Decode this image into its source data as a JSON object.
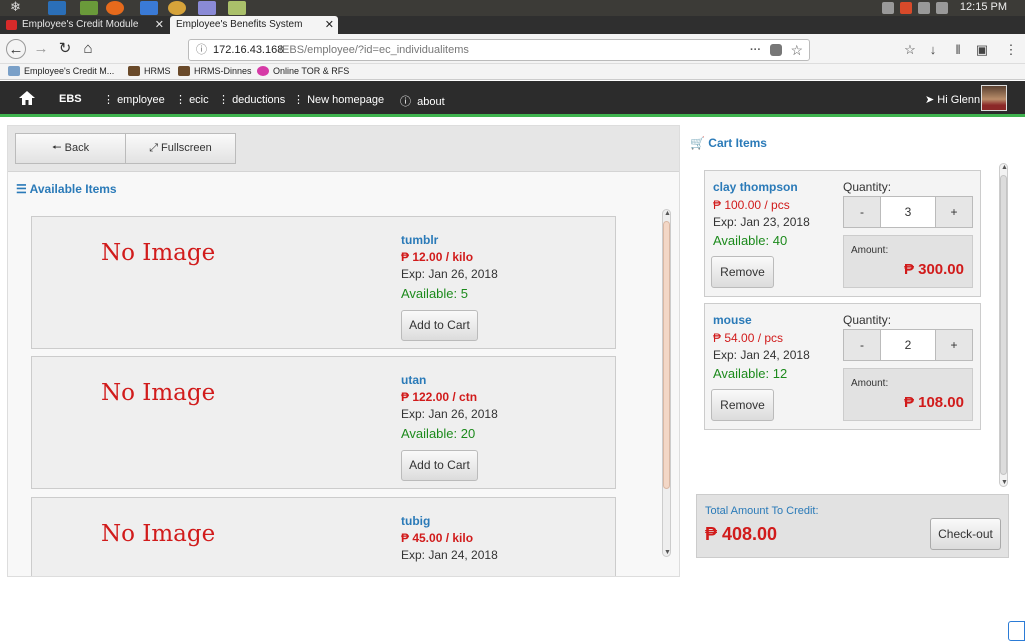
{
  "os": {
    "clock": "12:15 PM"
  },
  "browser": {
    "tabs": [
      {
        "label": "Employee's Credit Module",
        "active": false
      },
      {
        "label": "Employee's Benefits System",
        "active": true
      }
    ],
    "new_tab": "+",
    "url_host": "172.16.43.168",
    "url_path": "/EBS/employee/?id=ec_individualitems",
    "url_menu": "···",
    "bookmarks": [
      {
        "label": "Employee's Credit M..."
      },
      {
        "label": "HRMS"
      },
      {
        "label": "HRMS-Dinnes"
      },
      {
        "label": "Online TOR & RFS"
      }
    ]
  },
  "appnav": {
    "brand": "EBS",
    "menu": [
      {
        "label": "employee"
      },
      {
        "label": "ecic"
      },
      {
        "label": "deductions"
      },
      {
        "label": "New homepage"
      }
    ],
    "about": "about",
    "greeting": "Hi Glenn"
  },
  "toolbar": {
    "back": "Back",
    "fullscreen": "Fullscreen"
  },
  "available": {
    "title": "Available Items",
    "items": [
      {
        "image": "No Image",
        "name": "tumblr",
        "price": "₱ 12.00 / kilo",
        "exp": "Exp: Jan 26, 2018",
        "available": "Available: 5",
        "button": "Add to Cart"
      },
      {
        "image": "No Image",
        "name": "utan",
        "price": "₱ 122.00 / ctn",
        "exp": "Exp: Jan 26, 2018",
        "available": "Available: 20",
        "button": "Add to Cart"
      },
      {
        "image": "No Image",
        "name": "tubig",
        "price": "₱ 45.00 / kilo",
        "exp": "Exp: Jan 24, 2018",
        "available": "",
        "button": ""
      }
    ]
  },
  "cart": {
    "title": "Cart Items",
    "items": [
      {
        "name": "clay thompson",
        "price": "₱ 100.00 / pcs",
        "exp": "Exp: Jan 23, 2018",
        "available": "Available: 40",
        "remove": "Remove",
        "qty_label": "Quantity:",
        "minus": "-",
        "qty": "3",
        "plus": "+",
        "amount_label": "Amount:",
        "amount": "₱ 300.00"
      },
      {
        "name": "mouse",
        "price": "₱ 54.00 / pcs",
        "exp": "Exp: Jan 24, 2018",
        "available": "Available: 12",
        "remove": "Remove",
        "qty_label": "Quantity:",
        "minus": "-",
        "qty": "2",
        "plus": "+",
        "amount_label": "Amount:",
        "amount": "₱ 108.00"
      }
    ],
    "total_label": "Total Amount To Credit:",
    "total": "₱ 408.00",
    "checkout": "Check-out"
  },
  "colors": {
    "accent_blue": "#2a7ab8",
    "price_red": "#d11b1b",
    "available_green": "#1c8a1c",
    "nav_dark": "#2c2c2c",
    "nav_underline": "#3fb34f"
  }
}
